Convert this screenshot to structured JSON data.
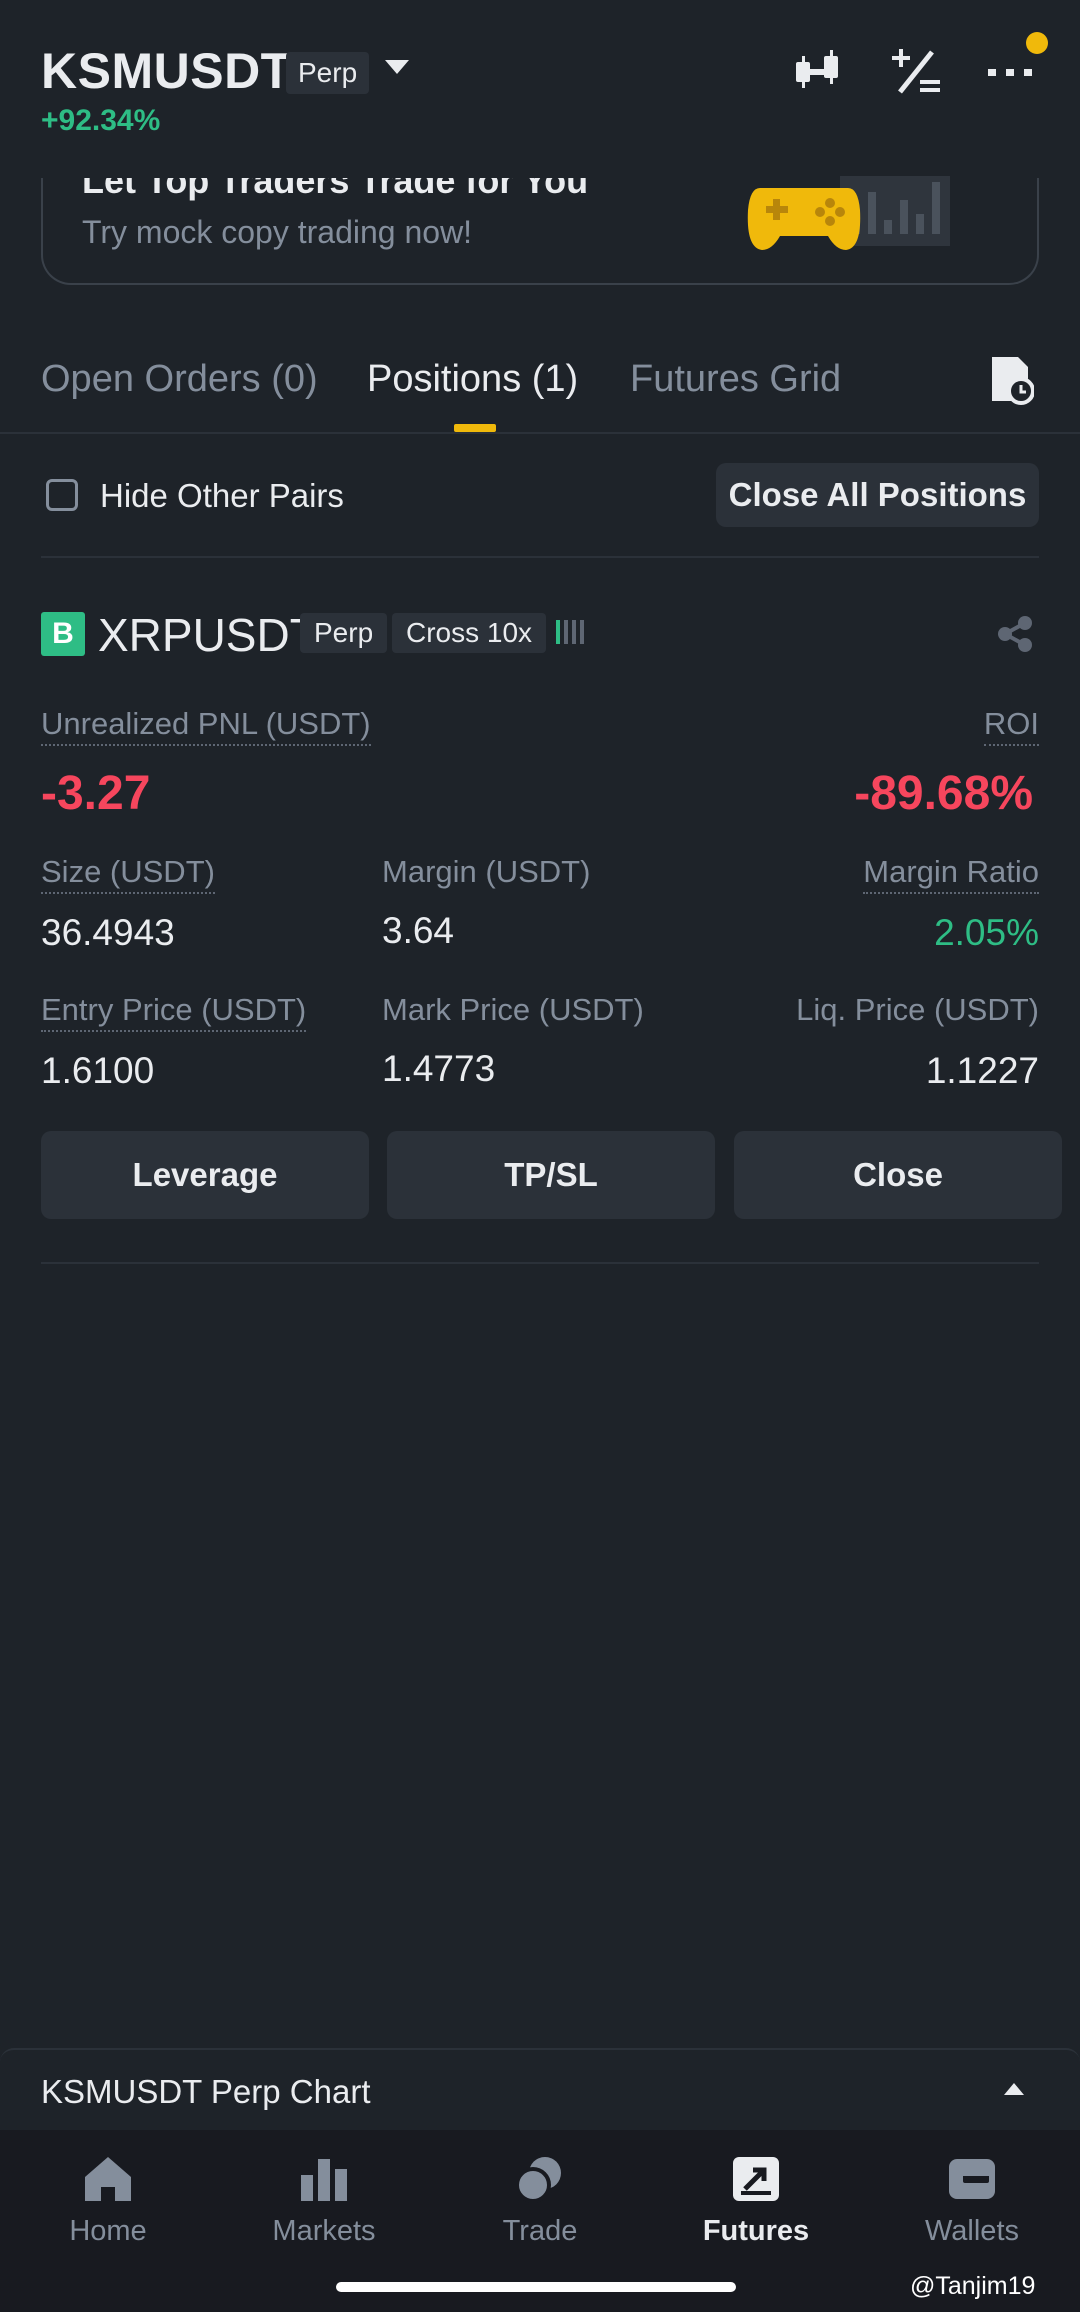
{
  "header": {
    "symbol": "KSMUSDT",
    "contract_type": "Perp",
    "change": "+92.34%",
    "icons": [
      "candlestick-chart-icon",
      "percent-calculator-icon",
      "more-icon"
    ]
  },
  "promo": {
    "title": "Let Top Traders Trade for You",
    "subtitle": "Try mock copy trading now!"
  },
  "tabs": [
    {
      "label": "Open Orders (0)"
    },
    {
      "label": "Positions (1)"
    },
    {
      "label": "Futures Grid"
    }
  ],
  "filter": {
    "hide_other_pairs": "Hide Other Pairs",
    "close_all": "Close All Positions"
  },
  "position": {
    "side": "B",
    "symbol": "XRPUSDT",
    "contract_type": "Perp",
    "margin_mode": "Cross 10x",
    "unrealized_pnl_label": "Unrealized PNL (USDT)",
    "unrealized_pnl": "-3.27",
    "roi_label": "ROI",
    "roi": "-89.68%",
    "size_label": "Size (USDT)",
    "size": "36.4943",
    "margin_label": "Margin (USDT)",
    "margin": "3.64",
    "margin_ratio_label": "Margin Ratio",
    "margin_ratio": "2.05%",
    "entry_price_label": "Entry Price (USDT)",
    "entry_price": "1.6100",
    "mark_price_label": "Mark Price (USDT)",
    "mark_price": "1.4773",
    "liq_price_label": "Liq. Price (USDT)",
    "liq_price": "1.1227",
    "buttons": {
      "leverage": "Leverage",
      "tpsl": "TP/SL",
      "close": "Close"
    }
  },
  "chart_bar": {
    "label": "KSMUSDT Perp Chart"
  },
  "nav": [
    {
      "label": "Home"
    },
    {
      "label": "Markets"
    },
    {
      "label": "Trade"
    },
    {
      "label": "Futures"
    },
    {
      "label": "Wallets"
    }
  ],
  "watermark": "@Tanjim19",
  "colors": {
    "background": "#1e2329",
    "accent": "#f0b90b",
    "up": "#2ebd85",
    "down": "#f6465d"
  }
}
